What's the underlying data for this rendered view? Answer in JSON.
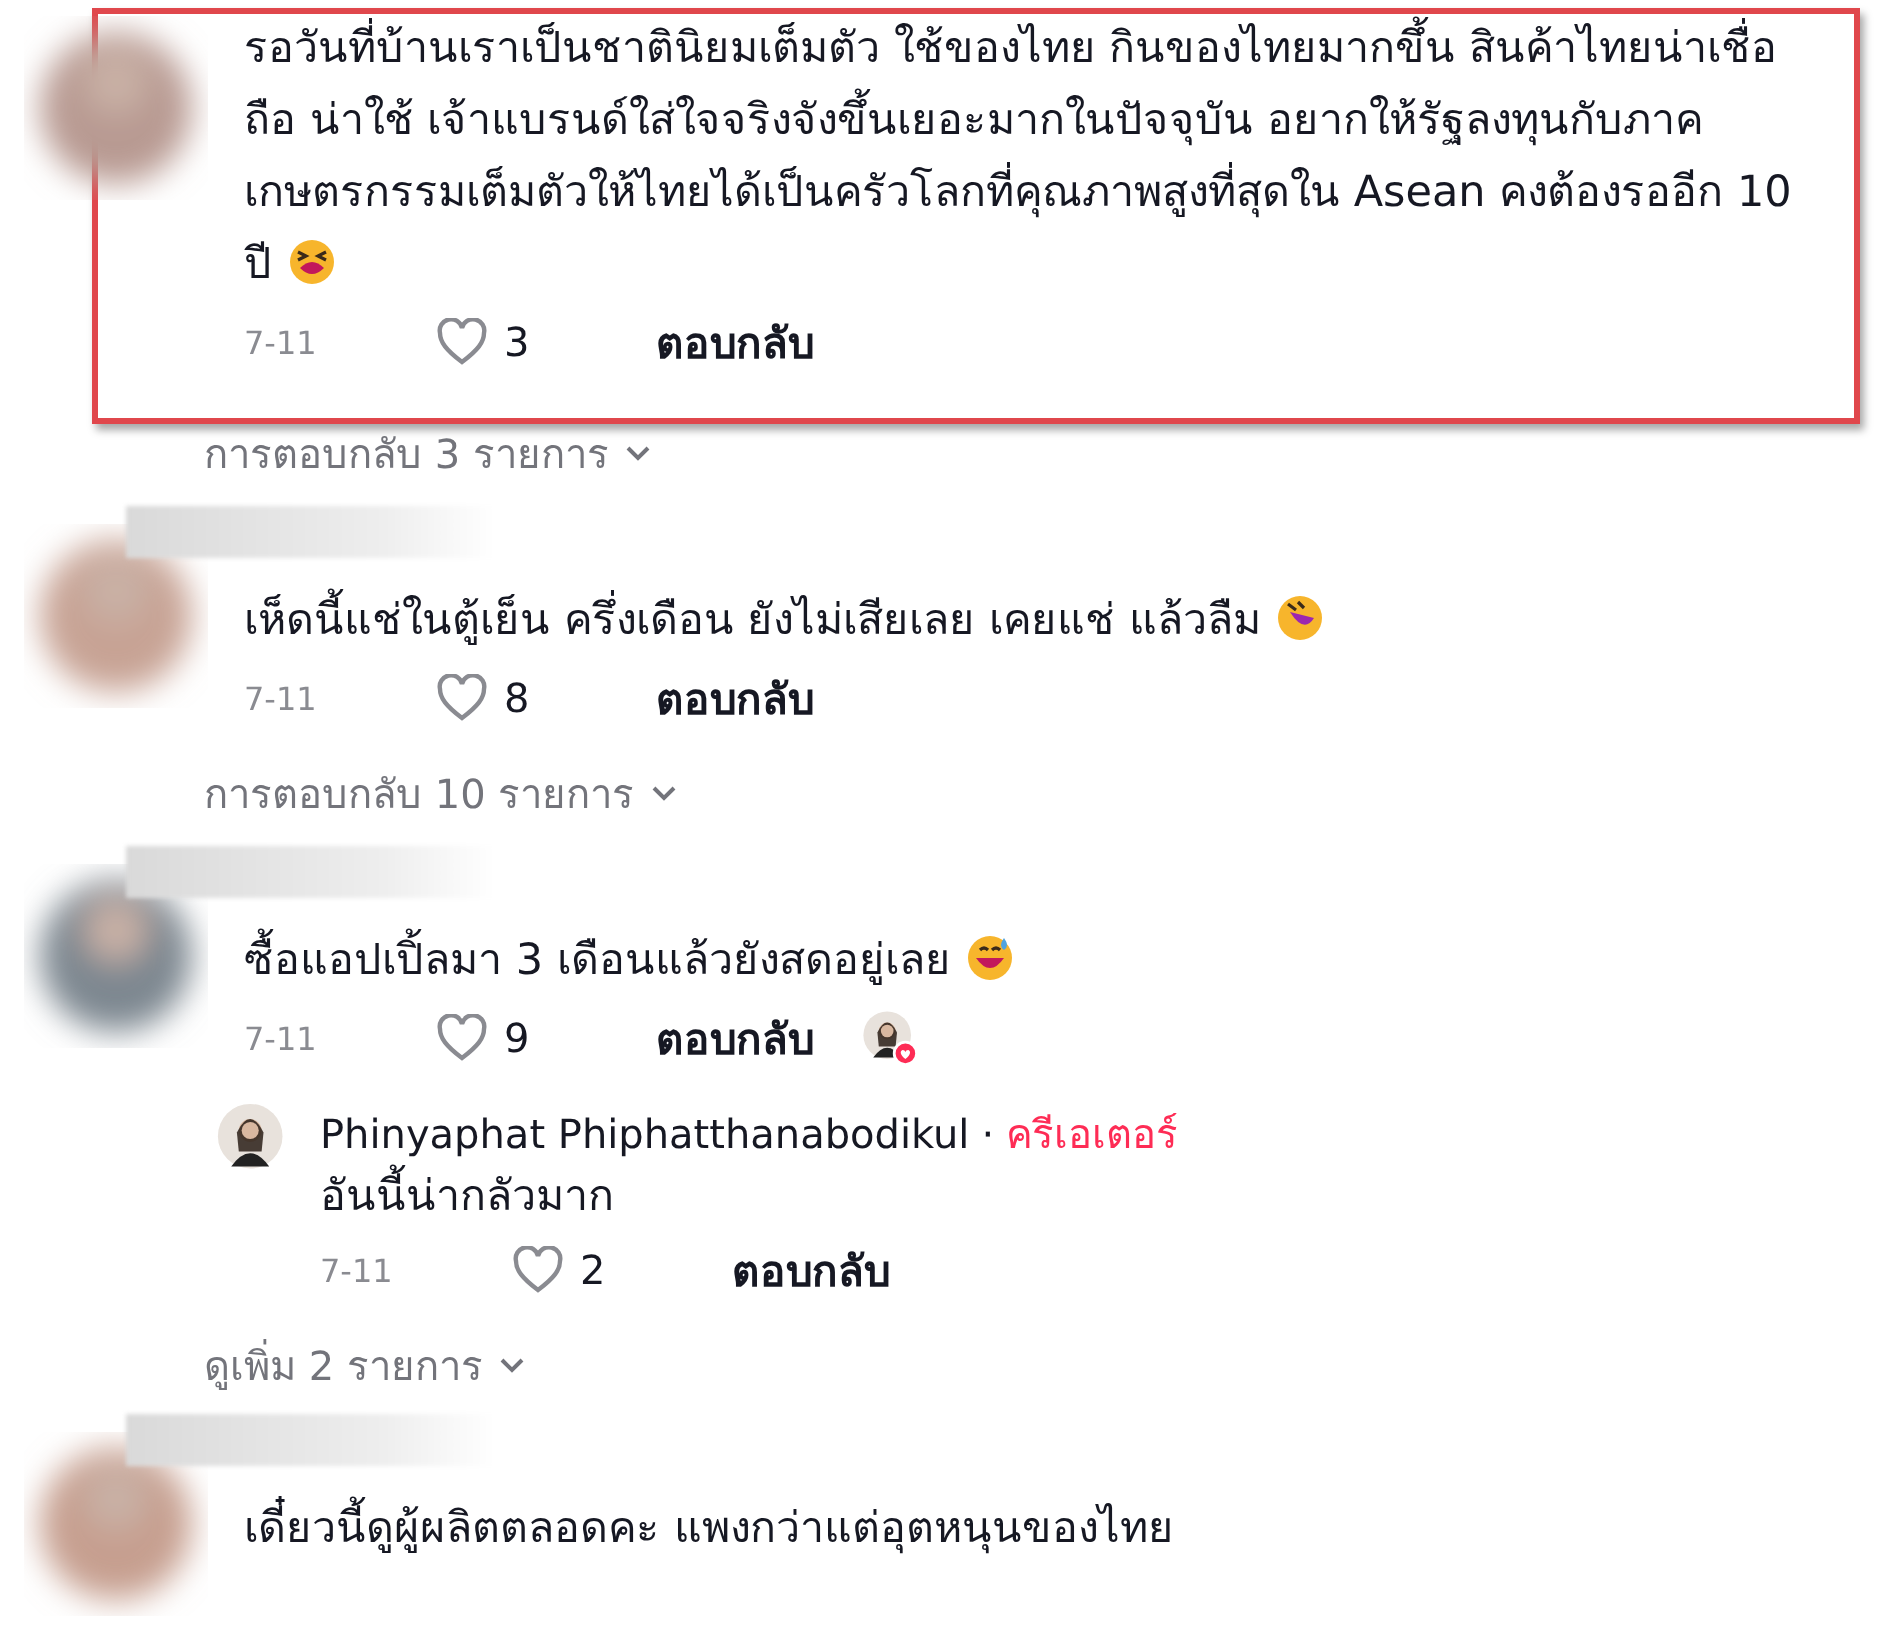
{
  "comments": [
    {
      "highlighted": true,
      "text": "รอวันที่บ้านเราเป็นชาตินิยมเต็มตัว ใช้ของไทย กินของไทยมากขึ้น สินค้าไทยน่าเชื่อถือ น่าใช้ เจ้าแบรนด์ใส่ใจจริงจังขึ้นเยอะมากในปัจจุบัน อยากให้รัฐลงทุนกับภาคเกษตรกรรมเต็มตัวให้ไทยได้เป็นครัวโลกที่คุณภาพสูงที่สุดใน Asean คงต้องรออีก 10 ปี",
      "emoji": true,
      "date": "7-11",
      "liked": false,
      "likes": "3",
      "reply_label": "ตอบกลับ",
      "creator_liked": false,
      "view_more": "การตอบกลับ 3 รายการ"
    },
    {
      "highlighted": false,
      "text": "เห็ดนี้แช่ในตู้เย็น ครึ่งเดือน ยังไม่เสียเลย เคยแช่ แล้วลืม",
      "emoji": true,
      "date": "7-11",
      "liked": false,
      "likes": "8",
      "reply_label": "ตอบกลับ",
      "creator_liked": false,
      "view_more": "การตอบกลับ 10 รายการ"
    },
    {
      "highlighted": false,
      "text": "ซื้อแอปเปิ้ลมา 3 เดือนแล้วยังสดอยู่เลย",
      "emoji": true,
      "date": "7-11",
      "liked": false,
      "likes": "9",
      "reply_label": "ตอบกลับ",
      "creator_liked": true,
      "replies": [
        {
          "author": "Phinyaphat Phiphatthanabodikul",
          "separator": "·",
          "badge": "ครีเอเตอร์",
          "text": "อันนี้น่ากลัวมาก",
          "date": "7-11",
          "liked": false,
          "likes": "2",
          "reply_label": "ตอบกลับ"
        }
      ],
      "view_more": "ดูเพิ่ม 2 รายการ"
    },
    {
      "highlighted": false,
      "text": "เดี๋ยวนี้ดูผู้ผลิตตลอดคะ แพงกว่าแต่อุตหนุนของไทย"
    }
  ]
}
